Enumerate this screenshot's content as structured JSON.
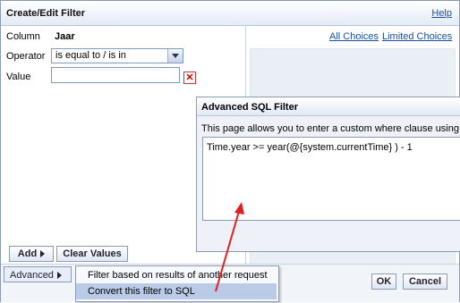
{
  "dialog": {
    "title": "Create/Edit Filter",
    "help_label": "Help"
  },
  "form": {
    "column_label": "Column",
    "column_value": "Jaar",
    "operator_label": "Operator",
    "operator_value": "is equal to / is in",
    "value_label": "Value",
    "value_input": ""
  },
  "right_panel": {
    "all_choices": "All Choices",
    "limited_choices": "Limited Choices"
  },
  "buttons": {
    "add": "Add",
    "clear_values": "Clear Values",
    "advanced": "Advanced",
    "ok": "OK",
    "cancel": "Cancel"
  },
  "advanced_menu": {
    "items": [
      "Filter based on results of another request",
      "Convert this filter to SQL"
    ],
    "selected_index": 1
  },
  "sql_filter": {
    "title": "Advanced SQL Filter",
    "description": "This page allows you to enter a custom where clause using",
    "expression": "Time.year >= year(@{system.currentTime} ) - 1"
  },
  "colors": {
    "link": "#1a4f9c",
    "annotation_arrow": "#e02020",
    "menu_selected": "#b9cbe6"
  }
}
